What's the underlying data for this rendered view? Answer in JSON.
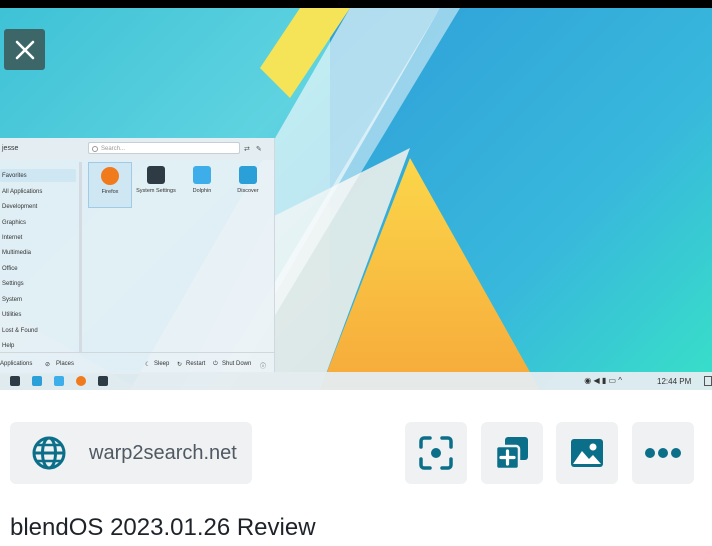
{
  "preview": {
    "close_icon": "close-icon",
    "launcher": {
      "user": "jesse",
      "search_placeholder": "Search...",
      "categories": [
        "Favorites",
        "All Applications",
        "Development",
        "Graphics",
        "Internet",
        "Multimedia",
        "Office",
        "Settings",
        "System",
        "Utilities",
        "Lost & Found",
        "Help"
      ],
      "apps": [
        {
          "label": "Firefox",
          "icon": "firefox-icon",
          "color": "#f07a1c"
        },
        {
          "label": "System Settings",
          "icon": "settings-icon",
          "color": "#2e3a44"
        },
        {
          "label": "Dolphin",
          "icon": "folder-icon",
          "color": "#3daee9"
        },
        {
          "label": "Discover",
          "icon": "discover-icon",
          "color": "#2b9fd8"
        }
      ],
      "footer": {
        "applications": "Applications",
        "places": "Places",
        "sleep": "Sleep",
        "restart": "Restart",
        "shutdown": "Shut Down"
      }
    },
    "taskbar": {
      "time": "12:44 PM"
    }
  },
  "source": {
    "icon": "globe-icon",
    "domain": "warp2search.net"
  },
  "actions": [
    {
      "name": "visual-search-button",
      "icon": "lens-scan-icon"
    },
    {
      "name": "copy-button",
      "icon": "add-copy-icon"
    },
    {
      "name": "save-image-button",
      "icon": "image-icon"
    },
    {
      "name": "more-button",
      "icon": "more-dots-icon"
    }
  ],
  "title": "blendOS 2023.01.26 Review",
  "colors": {
    "accent": "#0c6f8a",
    "pill_bg": "#f0f1f2"
  }
}
